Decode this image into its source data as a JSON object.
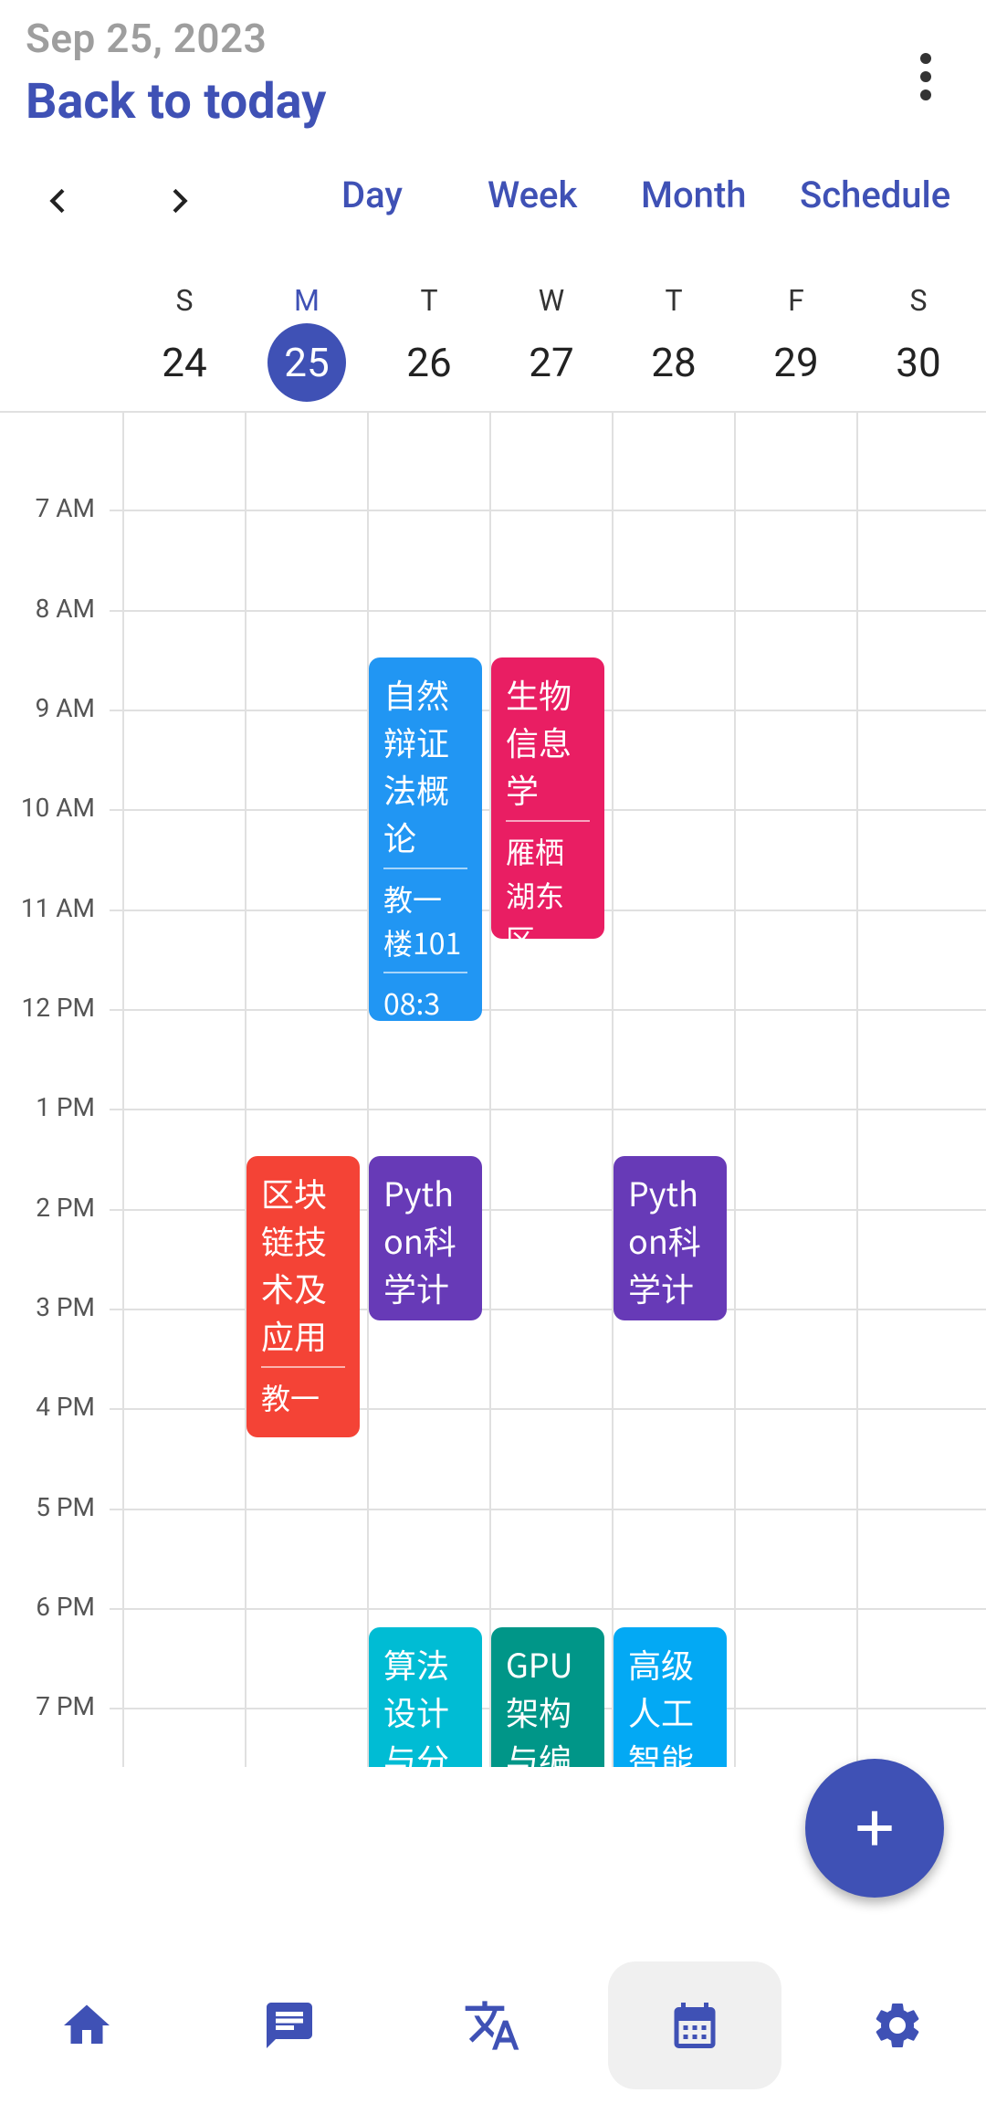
{
  "header": {
    "date": "Sep 25, 2023",
    "back_label": "Back to today",
    "views": [
      "Day",
      "Week",
      "Month",
      "Schedule"
    ]
  },
  "week": {
    "days": [
      {
        "dow": "S",
        "dom": "24"
      },
      {
        "dow": "M",
        "dom": "25"
      },
      {
        "dow": "T",
        "dom": "26"
      },
      {
        "dow": "W",
        "dom": "27"
      },
      {
        "dow": "T",
        "dom": "28"
      },
      {
        "dow": "F",
        "dom": "29"
      },
      {
        "dow": "S",
        "dom": "30"
      }
    ]
  },
  "hours": [
    "7 AM",
    "8 AM",
    "9 AM",
    "10 AM",
    "11 AM",
    "12 PM",
    "1 PM",
    "2 PM",
    "3 PM",
    "4 PM",
    "5 PM",
    "6 PM",
    "7 PM"
  ],
  "events": [
    {
      "title": "自然辩证法概论",
      "location": "教一楼101",
      "time": "08:3",
      "color": "#2196f3"
    },
    {
      "title": "生物信息学",
      "location": "雁栖湖东区",
      "color": "#e91e63"
    },
    {
      "title": "区块链技术及应用",
      "location": "教一",
      "color": "#f44336"
    },
    {
      "title": "Python科学计",
      "color": "#673ab7"
    },
    {
      "title": "Python科学计",
      "color": "#673ab7"
    },
    {
      "title": "算法设计与分",
      "color": "#00bcd4"
    },
    {
      "title": "GPU架构与编",
      "color": "#009688"
    },
    {
      "title": "高级人工智能",
      "color": "#03a9f4"
    }
  ],
  "colors": {
    "accent": "#3f51b5"
  }
}
